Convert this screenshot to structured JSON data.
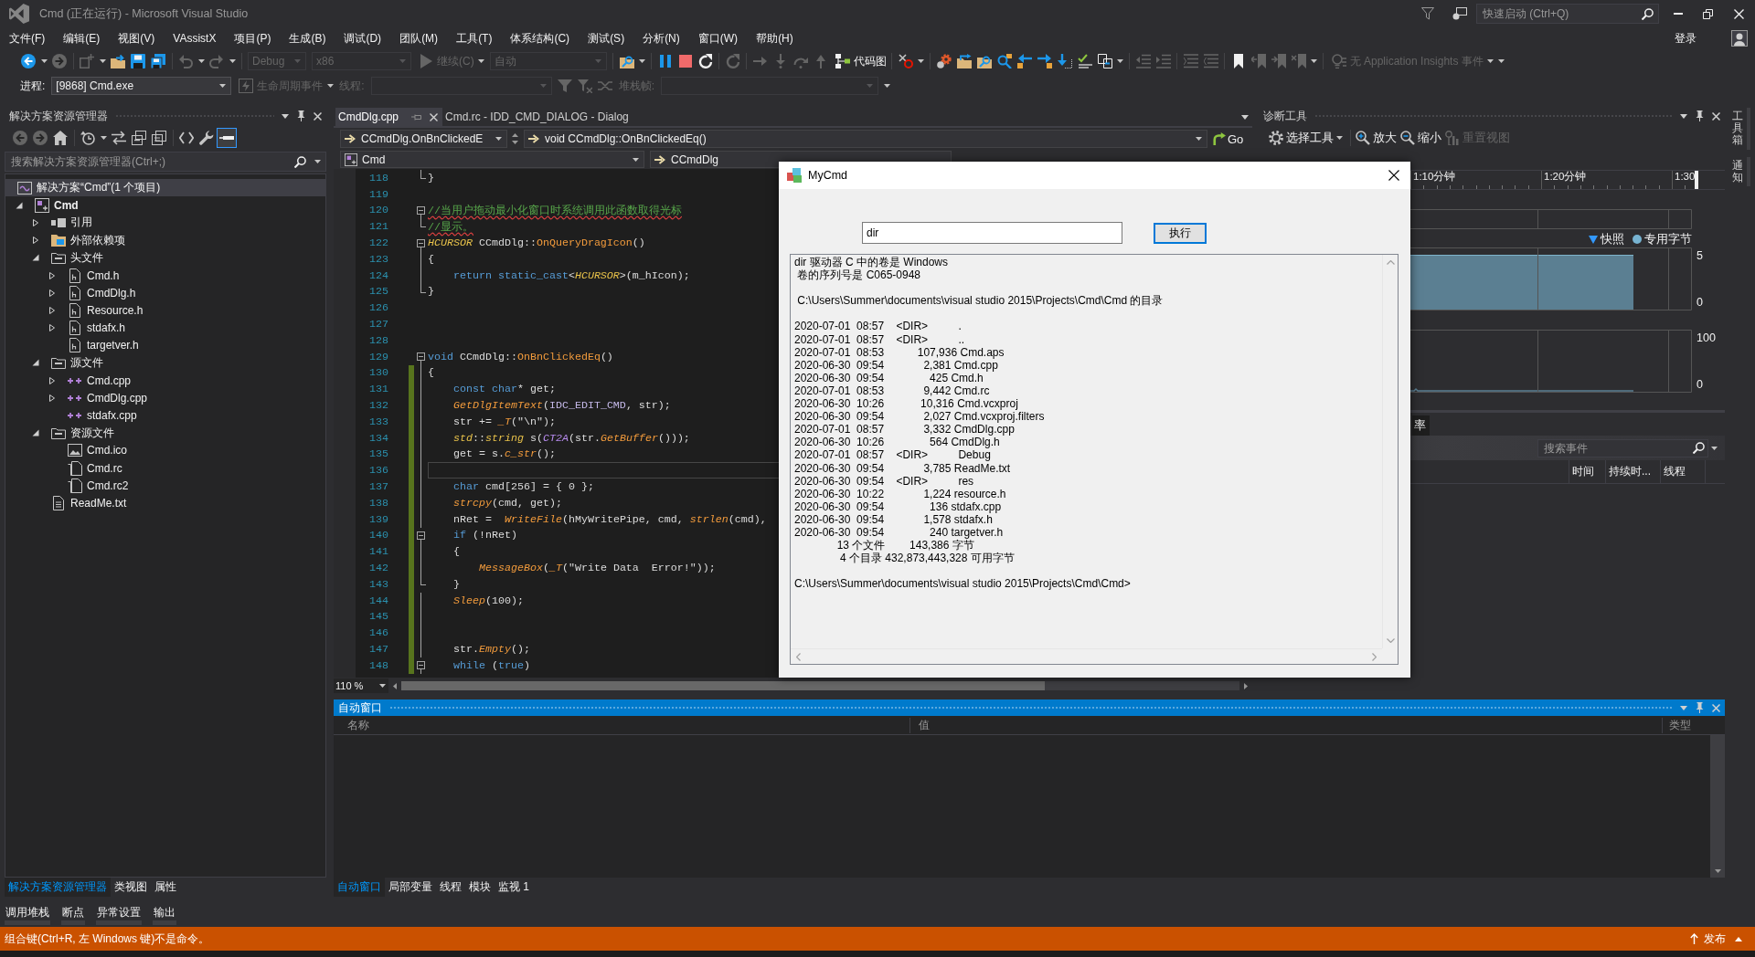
{
  "window": {
    "title": "Cmd (正在运行) - Microsoft Visual Studio",
    "quick_launch": {
      "placeholder": "快速启动 (Ctrl+Q)"
    },
    "account": "登录"
  },
  "menu": [
    "文件(F)",
    "编辑(E)",
    "视图(V)",
    "VAssistX",
    "项目(P)",
    "生成(B)",
    "调试(D)",
    "团队(M)",
    "工具(T)",
    "体系结构(C)",
    "测试(S)",
    "分析(N)",
    "窗口(W)",
    "帮助(H)"
  ],
  "toolbars": [
    {
      "items": [
        {
          "kind": "back",
          "disabled": false
        },
        {
          "kind": "caret"
        },
        {
          "kind": "forward",
          "disabled": true
        },
        {
          "kind": "sep"
        },
        {
          "kind": "newproject",
          "disabled": true
        },
        {
          "kind": "caret"
        },
        {
          "kind": "openfolder",
          "disabled": false
        },
        {
          "kind": "save",
          "disabled": false
        },
        {
          "kind": "saveall",
          "disabled": false
        },
        {
          "kind": "sep"
        },
        {
          "kind": "undo",
          "disabled": true
        },
        {
          "kind": "caret"
        },
        {
          "kind": "redo",
          "disabled": true
        },
        {
          "kind": "caret"
        },
        {
          "kind": "sep"
        },
        {
          "kind": "combo",
          "value": "Debug",
          "disabled": true
        },
        {
          "kind": "combo",
          "value": "x86",
          "disabled": true
        },
        {
          "kind": "play",
          "label": "继续(C)",
          "disabled": true
        },
        {
          "kind": "caret"
        },
        {
          "kind": "combo",
          "value": "自动",
          "disabled": true
        },
        {
          "kind": "sep"
        },
        {
          "kind": "findfolder",
          "disabled": false
        },
        {
          "kind": "caret"
        },
        {
          "kind": "sep"
        },
        {
          "kind": "pause",
          "disabled": false
        },
        {
          "kind": "stop",
          "disabled": false
        },
        {
          "kind": "restart",
          "disabled": false
        },
        {
          "kind": "sep"
        },
        {
          "kind": "refresh",
          "disabled": true
        },
        {
          "kind": "sep"
        },
        {
          "kind": "stepnext",
          "disabled": true
        },
        {
          "kind": "stepinto",
          "disabled": true
        },
        {
          "kind": "stepover",
          "disabled": true
        },
        {
          "kind": "stepout",
          "disabled": true
        },
        {
          "kind": "codemap",
          "label": "代码图",
          "disabled": false
        },
        {
          "kind": "sep"
        },
        {
          "kind": "bpdelete",
          "disabled": false
        },
        {
          "kind": "caret"
        },
        {
          "kind": "sep"
        },
        {
          "kind": "redgear",
          "disabled": false
        },
        {
          "kind": "folderarrow",
          "disabled": false
        },
        {
          "kind": "findfolder",
          "disabled": false
        },
        {
          "kind": "magnify",
          "disabled": false
        },
        {
          "kind": "leftarrow",
          "disabled": false
        },
        {
          "kind": "rightarrow",
          "disabled": false
        },
        {
          "kind": "downarrow",
          "disabled": false
        },
        {
          "kind": "spellcheck",
          "disabled": false
        },
        {
          "kind": "copy",
          "disabled": false
        },
        {
          "kind": "caret"
        },
        {
          "kind": "sep"
        },
        {
          "kind": "outdent",
          "disabled": true
        },
        {
          "kind": "indent",
          "disabled": true
        },
        {
          "kind": "sep"
        },
        {
          "kind": "comment",
          "disabled": true
        },
        {
          "kind": "uncomment",
          "disabled": true
        },
        {
          "kind": "sep"
        },
        {
          "kind": "bookmark",
          "disabled": false
        },
        {
          "kind": "bookmarkprev",
          "disabled": true
        },
        {
          "kind": "bookmarknext",
          "disabled": true
        },
        {
          "kind": "bookmarkclear",
          "disabled": true
        },
        {
          "kind": "caret"
        },
        {
          "kind": "sep"
        },
        {
          "kind": "bulb",
          "label": "无 Application Insights 事件",
          "disabled": true
        },
        {
          "kind": "caret"
        },
        {
          "kind": "caret"
        }
      ]
    },
    {
      "items": [
        {
          "kind": "label",
          "text": "进程:",
          "disabled": false
        },
        {
          "kind": "combo",
          "value": "[9868] Cmd.exe",
          "disabled": false
        },
        {
          "kind": "bolt",
          "label": "生命周期事件",
          "disabled": true
        },
        {
          "kind": "caret"
        },
        {
          "kind": "label",
          "text": "线程:",
          "disabled": true
        },
        {
          "kind": "combo",
          "disabled": true
        },
        {
          "kind": "filter",
          "disabled": true
        },
        {
          "kind": "filterx",
          "disabled": true
        },
        {
          "kind": "swap",
          "disabled": true
        },
        {
          "kind": "label",
          "text": "堆栈帧:",
          "disabled": true
        },
        {
          "kind": "combo",
          "disabled": true
        },
        {
          "kind": "caret"
        }
      ]
    }
  ],
  "explorer": {
    "title": "解决方案资源管理器",
    "toolbar": [
      {
        "kind": "back",
        "disabled": true
      },
      {
        "kind": "forward",
        "disabled": true
      },
      {
        "kind": "home",
        "disabled": false
      },
      {
        "kind": "sep"
      },
      {
        "kind": "history",
        "disabled": false
      },
      {
        "kind": "caret"
      },
      {
        "kind": "sync",
        "disabled": false
      },
      {
        "kind": "collapse",
        "disabled": false
      },
      {
        "kind": "showall",
        "disabled": false
      },
      {
        "kind": "sep"
      },
      {
        "kind": "code",
        "disabled": false
      },
      {
        "kind": "wrench",
        "disabled": false
      },
      {
        "kind": "preview",
        "disabled": false,
        "on": true
      }
    ],
    "search": {
      "placeholder": "搜索解决方案资源管理器(Ctrl+;)"
    },
    "tree": [
      {
        "label": "解决方案“Cmd”(1 个项目)",
        "kind": "solution",
        "selected": true,
        "children": [
          {
            "label": "Cmd",
            "kind": "project",
            "selected": false,
            "expanded": true,
            "children": [
              {
                "label": "引用",
                "kind": "references",
                "selected": false,
                "expanded": false
              },
              {
                "label": "外部依赖项",
                "kind": "dependencies",
                "selected": false,
                "expanded": false
              },
              {
                "label": "头文件",
                "kind": "filter",
                "selected": false,
                "expanded": true,
                "children": [
                  {
                    "label": "Cmd.h",
                    "kind": "header",
                    "selected": false,
                    "expanded": false
                  },
                  {
                    "label": "CmdDlg.h",
                    "kind": "header",
                    "selected": false,
                    "expanded": false
                  },
                  {
                    "label": "Resource.h",
                    "kind": "header",
                    "selected": false,
                    "expanded": false
                  },
                  {
                    "label": "stdafx.h",
                    "kind": "header",
                    "selected": false,
                    "expanded": false
                  },
                  {
                    "label": "targetver.h",
                    "kind": "header",
                    "selected": false
                  }
                ]
              },
              {
                "label": "源文件",
                "kind": "filter",
                "selected": false,
                "expanded": true,
                "children": [
                  {
                    "label": "Cmd.cpp",
                    "kind": "source",
                    "selected": false,
                    "expanded": false
                  },
                  {
                    "label": "CmdDlg.cpp",
                    "kind": "source",
                    "selected": false,
                    "expanded": false
                  },
                  {
                    "label": "stdafx.cpp",
                    "kind": "source",
                    "selected": false
                  }
                ]
              },
              {
                "label": "资源文件",
                "kind": "filter",
                "selected": false,
                "expanded": true,
                "children": [
                  {
                    "label": "Cmd.ico",
                    "kind": "image",
                    "selected": false
                  },
                  {
                    "label": "Cmd.rc",
                    "kind": "resource",
                    "selected": false
                  },
                  {
                    "label": "Cmd.rc2",
                    "kind": "resource",
                    "selected": false
                  }
                ]
              },
              {
                "label": "ReadMe.txt",
                "kind": "text",
                "selected": false
              }
            ]
          }
        ]
      }
    ],
    "tabs": [
      {
        "label": "解决方案资源管理器",
        "selected": true
      },
      {
        "label": "类视图",
        "selected": false
      },
      {
        "label": "属性",
        "selected": false
      }
    ]
  },
  "editor": {
    "tabs": [
      {
        "label": "CmdDlg.cpp",
        "selected": true
      },
      {
        "label": "Cmd.rc - IDD_CMD_DIALOG - Dialog",
        "selected": false
      }
    ],
    "members": [
      "CCmdDlg.OnBnClickedE",
      "void CCmdDlg::OnBnClickedEq()"
    ],
    "go": "Go",
    "scope": [
      "Cmd",
      "CCmdDlg"
    ],
    "zoom": "110 %",
    "lines": [
      {
        "number": "118",
        "kind": "end",
        "changed": false,
        "current": false,
        "segments": [
          {
            "kind": "plain",
            "text": "}"
          }
        ]
      },
      {
        "number": "119",
        "kind": "plain",
        "changed": false,
        "current": false
      },
      {
        "number": "120",
        "kind": "start",
        "changed": false,
        "current": false,
        "segments": [
          {
            "kind": "flagged",
            "text": "//当用户拖动最小化窗口时系统调用此函数取得光标"
          }
        ]
      },
      {
        "number": "121",
        "kind": "end",
        "changed": false,
        "current": false,
        "segments": [
          {
            "kind": "flagged",
            "text": "//显示。"
          }
        ]
      },
      {
        "number": "122",
        "kind": "start",
        "changed": false,
        "current": false,
        "segments": [
          {
            "kind": "type",
            "text": "HCURSOR"
          },
          {
            "kind": "plain",
            "text": " CCmdDlg::"
          },
          {
            "kind": "method",
            "text": "OnQueryDragIcon"
          },
          {
            "kind": "plain",
            "text": "()"
          }
        ]
      },
      {
        "number": "123",
        "kind": "mid",
        "changed": false,
        "current": false,
        "segments": [
          {
            "kind": "plain",
            "text": "{"
          }
        ]
      },
      {
        "number": "124",
        "kind": "mid",
        "changed": false,
        "current": false,
        "segments": [
          {
            "kind": "keyword",
            "text": "    return static_cast"
          },
          {
            "kind": "plain",
            "text": "<"
          },
          {
            "kind": "type",
            "text": "HCURSOR"
          },
          {
            "kind": "plain",
            "text": ">(m_hIcon);"
          }
        ]
      },
      {
        "number": "125",
        "kind": "end",
        "changed": false,
        "current": false,
        "segments": [
          {
            "kind": "plain",
            "text": "}"
          }
        ]
      },
      {
        "number": "126",
        "kind": "plain",
        "changed": false,
        "current": false
      },
      {
        "number": "127",
        "kind": "plain",
        "changed": false,
        "current": false
      },
      {
        "number": "128",
        "kind": "plain",
        "changed": false,
        "current": false
      },
      {
        "number": "129",
        "kind": "start",
        "changed": false,
        "current": false,
        "segments": [
          {
            "kind": "keyword",
            "text": "void"
          },
          {
            "kind": "plain",
            "text": " CCmdDlg::"
          },
          {
            "kind": "method",
            "text": "OnBnClickedEq"
          },
          {
            "kind": "plain",
            "text": "()"
          }
        ]
      },
      {
        "number": "130",
        "kind": "mid",
        "changed": true,
        "current": false,
        "segments": [
          {
            "kind": "plain",
            "text": "{"
          }
        ]
      },
      {
        "number": "131",
        "kind": "mid",
        "changed": true,
        "current": false,
        "segments": [
          {
            "kind": "keyword",
            "text": "    const char"
          },
          {
            "kind": "plain",
            "text": "* get;"
          }
        ]
      },
      {
        "number": "132",
        "kind": "mid",
        "changed": true,
        "current": false,
        "segments": [
          {
            "kind": "call",
            "text": "    GetDlgItemText"
          },
          {
            "kind": "plain",
            "text": "("
          },
          {
            "kind": "macro",
            "text": "IDC_EDIT_CMD"
          },
          {
            "kind": "plain",
            "text": ", str);"
          }
        ]
      },
      {
        "number": "133",
        "kind": "mid",
        "changed": true,
        "current": false,
        "segments": [
          {
            "kind": "plain",
            "text": "    str += "
          },
          {
            "kind": "call",
            "text": "_T"
          },
          {
            "kind": "plain",
            "text": "(\"\\n\");"
          }
        ]
      },
      {
        "number": "134",
        "kind": "mid",
        "changed": true,
        "current": false,
        "segments": [
          {
            "kind": "type",
            "text": "    std"
          },
          {
            "kind": "plain",
            "text": "::"
          },
          {
            "kind": "type",
            "text": "string"
          },
          {
            "kind": "plain",
            "text": " s("
          },
          {
            "kind": "macrocall",
            "text": "CT2A"
          },
          {
            "kind": "plain",
            "text": "(str."
          },
          {
            "kind": "call",
            "text": "GetBuffer"
          },
          {
            "kind": "plain",
            "text": "()));"
          }
        ]
      },
      {
        "number": "135",
        "kind": "mid",
        "changed": true,
        "current": false,
        "segments": [
          {
            "kind": "plain",
            "text": "    get = s."
          },
          {
            "kind": "call",
            "text": "c_str"
          },
          {
            "kind": "plain",
            "text": "();"
          }
        ]
      },
      {
        "number": "136",
        "kind": "mid",
        "changed": true,
        "current": true
      },
      {
        "number": "137",
        "kind": "mid",
        "changed": true,
        "current": false,
        "segments": [
          {
            "kind": "keyword",
            "text": "    char"
          },
          {
            "kind": "plain",
            "text": " cmd[256] = { 0 };"
          }
        ]
      },
      {
        "number": "138",
        "kind": "mid",
        "changed": true,
        "current": false,
        "segments": [
          {
            "kind": "call",
            "text": "    strcpy"
          },
          {
            "kind": "plain",
            "text": "(cmd, get);"
          }
        ]
      },
      {
        "number": "139",
        "kind": "mid",
        "changed": true,
        "current": false,
        "segments": [
          {
            "kind": "plain",
            "text": "    nRet =  "
          },
          {
            "kind": "call",
            "text": "WriteFile"
          },
          {
            "kind": "plain",
            "text": "(hMyWritePipe, cmd, "
          },
          {
            "kind": "call",
            "text": "strlen"
          },
          {
            "kind": "plain",
            "text": "(cmd),"
          }
        ]
      },
      {
        "number": "140",
        "kind": "start",
        "changed": true,
        "current": false,
        "segments": [
          {
            "kind": "keyword",
            "text": "    if"
          },
          {
            "kind": "plain",
            "text": " (!nRet)"
          }
        ]
      },
      {
        "number": "141",
        "kind": "mid",
        "changed": true,
        "current": false,
        "segments": [
          {
            "kind": "plain",
            "text": "    {"
          }
        ]
      },
      {
        "number": "142",
        "kind": "mid",
        "changed": true,
        "current": false,
        "segments": [
          {
            "kind": "call",
            "text": "        MessageBox"
          },
          {
            "kind": "plain",
            "text": "("
          },
          {
            "kind": "call",
            "text": "_T"
          },
          {
            "kind": "plain",
            "text": "(\"Write Data  Error!\"));"
          }
        ]
      },
      {
        "number": "143",
        "kind": "end",
        "changed": true,
        "current": false,
        "segments": [
          {
            "kind": "plain",
            "text": "    }"
          }
        ]
      },
      {
        "number": "144",
        "kind": "mid",
        "changed": true,
        "current": false,
        "segments": [
          {
            "kind": "call",
            "text": "    Sleep"
          },
          {
            "kind": "plain",
            "text": "(100);"
          }
        ]
      },
      {
        "number": "145",
        "kind": "mid",
        "changed": true,
        "current": false
      },
      {
        "number": "146",
        "kind": "mid",
        "changed": true,
        "current": false
      },
      {
        "number": "147",
        "kind": "mid",
        "changed": true,
        "current": false,
        "segments": [
          {
            "kind": "plain",
            "text": "    str."
          },
          {
            "kind": "call",
            "text": "Empty"
          },
          {
            "kind": "plain",
            "text": "();"
          }
        ]
      },
      {
        "number": "148",
        "kind": "start",
        "changed": true,
        "current": false,
        "segments": [
          {
            "kind": "keyword",
            "text": "    while"
          },
          {
            "kind": "plain",
            "text": " ("
          },
          {
            "kind": "keyword",
            "text": "true"
          },
          {
            "kind": "plain",
            "text": ")"
          }
        ]
      }
    ]
  },
  "diagnostics": {
    "title": "诊断工具",
    "tools": [
      {
        "kind": "select",
        "label": "选择工具",
        "disabled": false
      },
      {
        "kind": "zoomin",
        "label": "放大",
        "disabled": false
      },
      {
        "kind": "zoomout",
        "label": "缩小",
        "disabled": false
      },
      {
        "kind": "reset",
        "label": "重置视图",
        "disabled": true
      }
    ],
    "timeline": [
      "1:10分钟",
      "1:20分钟",
      "1:30"
    ],
    "legend": [
      {
        "kind": "triangle",
        "label": "快照",
        "color": "#3399ff"
      },
      {
        "kind": "dot",
        "label": "专用字节",
        "color": "#77b3d1"
      }
    ],
    "memory_axis": [
      "5",
      "0"
    ],
    "cpu_axis": [
      "100",
      "0"
    ],
    "tabs": [
      {
        "label": "率",
        "selected": true
      }
    ],
    "search": {
      "placeholder": "搜索事件"
    },
    "columns": [
      "时间",
      "持续时...",
      "线程"
    ]
  },
  "autos": {
    "title": "自动窗口",
    "columns": [
      "名称",
      "值",
      "类型"
    ],
    "tabs": [
      {
        "label": "自动窗口",
        "selected": true
      },
      {
        "label": "局部变量",
        "selected": false
      },
      {
        "label": "线程",
        "selected": false
      },
      {
        "label": "模块",
        "selected": false
      },
      {
        "label": "监视 1",
        "selected": false
      }
    ]
  },
  "tool_tabs": [
    "调用堆栈",
    "断点",
    "异常设置",
    "输出"
  ],
  "side_tabs": [
    "工具箱",
    "通知"
  ],
  "status": {
    "message": "组合键(Ctrl+R, 左 Windows 键)不是命令。",
    "publish": "发布"
  },
  "dialog": {
    "title": "MyCmd",
    "command": {
      "value": "dir"
    },
    "run": "执行",
    "output": {
      "value": "dir 驱动器 C 中的卷是 Windows\n 卷的序列号是 C065-0948\n\n C:\\Users\\Summer\\documents\\visual studio 2015\\Projects\\Cmd\\Cmd 的目录\n\n2020-07-01  08:57    <DIR>          .\n2020-07-01  08:57    <DIR>          ..\n2020-07-01  08:53           107,936 Cmd.aps\n2020-06-30  09:54             2,381 Cmd.cpp\n2020-06-30  09:54               425 Cmd.h\n2020-07-01  08:53             9,442 Cmd.rc\n2020-06-30  10:26            10,316 Cmd.vcxproj\n2020-06-30  09:54             2,027 Cmd.vcxproj.filters\n2020-07-01  08:57             3,332 CmdDlg.cpp\n2020-06-30  10:26               564 CmdDlg.h\n2020-07-01  08:57    <DIR>          Debug\n2020-06-30  09:54             3,785 ReadMe.txt\n2020-06-30  09:54    <DIR>          res\n2020-06-30  10:22             1,224 resource.h\n2020-06-30  09:54               136 stdafx.cpp\n2020-06-30  09:54             1,578 stdafx.h\n2020-06-30  09:54               240 targetver.h\n              13 个文件        143,386 字节\n               4 个目录 432,873,443,328 可用字节\n\nC:\\Users\\Summer\\documents\\visual studio 2015\\Projects\\Cmd\\Cmd>"
    }
  }
}
